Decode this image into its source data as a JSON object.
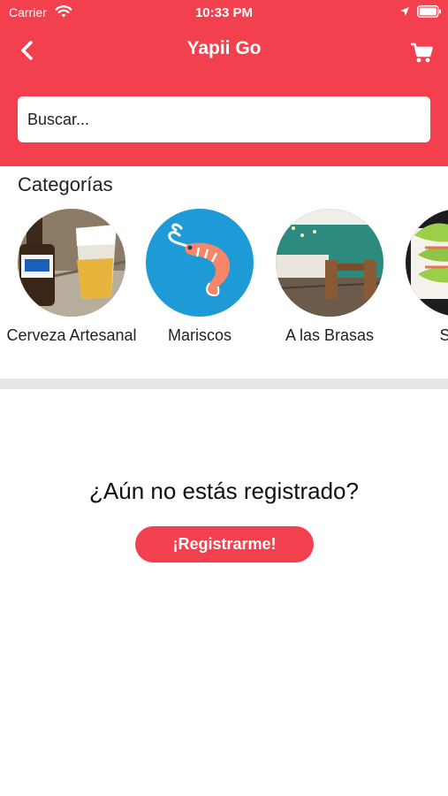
{
  "status_bar": {
    "carrier": "Carrier",
    "time": "10:33 PM"
  },
  "nav": {
    "title": "Yapii Go",
    "back_icon": "chevron-left-icon",
    "cart_icon": "shopping-cart-icon"
  },
  "search": {
    "placeholder": "Buscar..."
  },
  "categories": {
    "title": "Categorías",
    "items": [
      {
        "label": "Cerveza Artesanal"
      },
      {
        "label": "Mariscos"
      },
      {
        "label": "A las Brasas"
      },
      {
        "label": "Sushi"
      }
    ]
  },
  "register": {
    "question": "¿Aún no estás registrado?",
    "button_label": "¡Registrarme!"
  },
  "colors": {
    "brand": "#f2404f",
    "mariscos_bg": "#1e9ad6",
    "divider": "#e6e6e6"
  }
}
